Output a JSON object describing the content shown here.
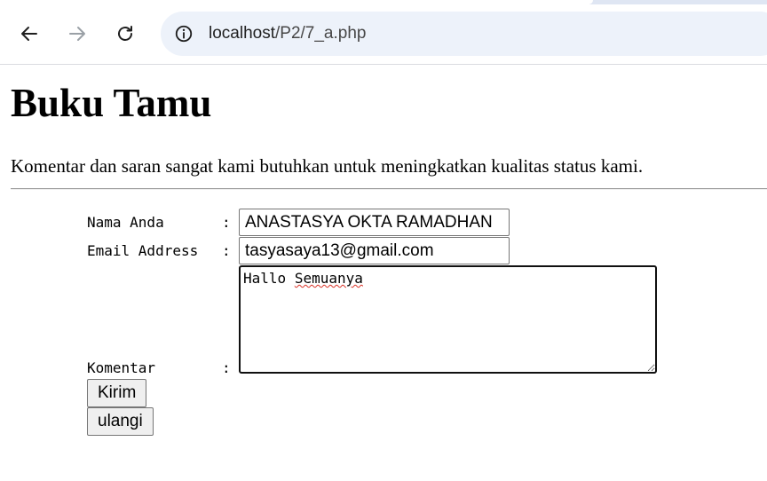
{
  "browser": {
    "url_host": "localhost",
    "url_path": "/P2/7_a.php",
    "icons": {
      "back": "arrow-left-icon",
      "forward": "arrow-right-icon",
      "reload": "reload-icon",
      "site_info": "info-icon"
    }
  },
  "page": {
    "title": "Buku Tamu",
    "intro": "Komentar dan saran sangat kami butuhkan untuk meningkatkan kualitas status kami."
  },
  "form": {
    "name_label": "Nama Anda",
    "name_value": "ANASTASYA OKTA RAMADHAN",
    "email_label": "Email Address",
    "email_value": "tasyasaya13@gmail.com",
    "comment_label": "Komentar",
    "comment_first_word": "Hallo",
    "comment_second_word": "Semuanya",
    "colon": ":",
    "submit_label": "Kirim",
    "reset_label": "ulangi"
  }
}
